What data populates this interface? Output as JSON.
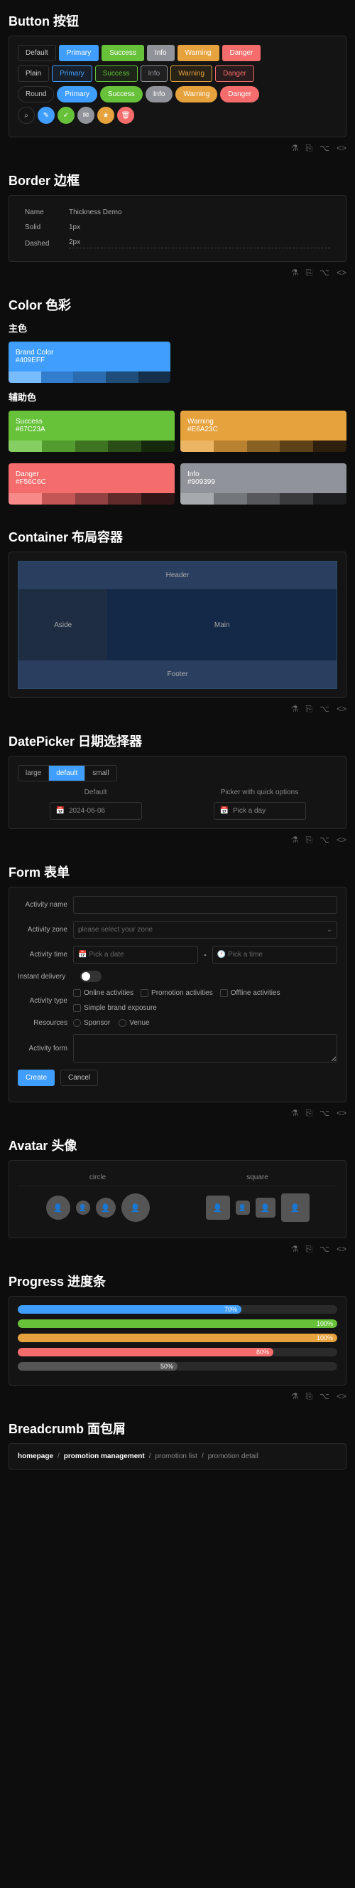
{
  "sections": {
    "button": {
      "title": "Button 按钮",
      "variants": [
        "Default",
        "Primary",
        "Success",
        "Info",
        "Warning",
        "Danger"
      ],
      "plain_first": "Plain",
      "round_first": "Round"
    },
    "border": {
      "title": "Border 边框",
      "rows": [
        [
          "Name",
          "Thickness Demo"
        ],
        [
          "Solid",
          "1px"
        ],
        [
          "Dashed",
          "2px"
        ]
      ]
    },
    "color": {
      "title": "Color 色彩",
      "primary_label": "主色",
      "aux_label": "辅助色",
      "brand": {
        "name": "Brand Color",
        "hex": "#409EFF"
      },
      "aux": [
        {
          "name": "Success",
          "hex": "#67C23A"
        },
        {
          "name": "Warning",
          "hex": "#E6A23C"
        },
        {
          "name": "Danger",
          "hex": "#F56C6C"
        },
        {
          "name": "Info",
          "hex": "#909399"
        }
      ]
    },
    "container": {
      "title": "Container 布局容器",
      "header": "Header",
      "aside": "Aside",
      "main": "Main",
      "footer": "Footer"
    },
    "datepicker": {
      "title": "DatePicker 日期选择器",
      "sizes": [
        "large",
        "default",
        "small"
      ],
      "col1": "Default",
      "col2": "Picker with quick options",
      "value": "2024-06-06",
      "placeholder": "Pick a day"
    },
    "form": {
      "title": "Form 表单",
      "labels": {
        "name": "Activity name",
        "zone": "Activity zone",
        "time": "Activity time",
        "instant": "Instant delivery",
        "type": "Activity type",
        "resources": "Resources",
        "form": "Activity form"
      },
      "zone_ph": "please select your zone",
      "time_ph1": "Pick a date",
      "time_ph2": "Pick a time",
      "types": [
        "Online activities",
        "Promotion activities",
        "Offline activities",
        "Simple brand exposure"
      ],
      "resources": [
        "Sponsor",
        "Venue"
      ],
      "create": "Create",
      "cancel": "Cancel"
    },
    "avatar": {
      "title": "Avatar 头像",
      "circle": "circle",
      "square": "square"
    },
    "progress": {
      "title": "Progress 进度条",
      "bars": [
        {
          "pct": 70,
          "color": "#409EFF"
        },
        {
          "pct": 100,
          "color": "#67C23A"
        },
        {
          "pct": 100,
          "color": "#E6A23C"
        },
        {
          "pct": 80,
          "color": "#F56C6C"
        },
        {
          "pct": 50,
          "color": "#555"
        }
      ]
    },
    "breadcrumb": {
      "title": "Breadcrumb 面包屑",
      "items": [
        "homepage",
        "promotion management",
        "promotion list",
        "promotion detail"
      ]
    }
  }
}
